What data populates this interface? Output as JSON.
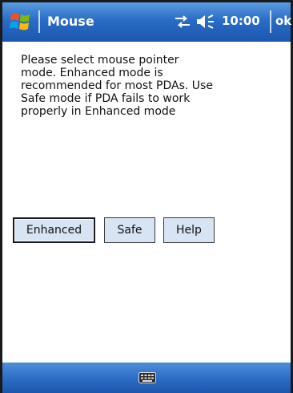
{
  "title_bar": {
    "app_title": "Mouse",
    "clock": "10:00",
    "ok_label": "ok",
    "icons": [
      "windows-start-icon",
      "connectivity-icon",
      "volume-icon"
    ]
  },
  "message": {
    "lines": [
      "Please select mouse pointer",
      "mode. Enhanced mode is",
      "recommended for most PDAs. Use",
      "Safe mode if PDA fails to work",
      "properly in Enhanced mode"
    ]
  },
  "buttons": {
    "enhanced": "Enhanced",
    "safe": "Safe",
    "help": "Help"
  },
  "menu_bar": {
    "icons": [
      "keyboard-icon"
    ]
  },
  "colors": {
    "title_bar": "#2a6cc6",
    "button_face": "#d7e4f3",
    "background": "#ffffff"
  }
}
